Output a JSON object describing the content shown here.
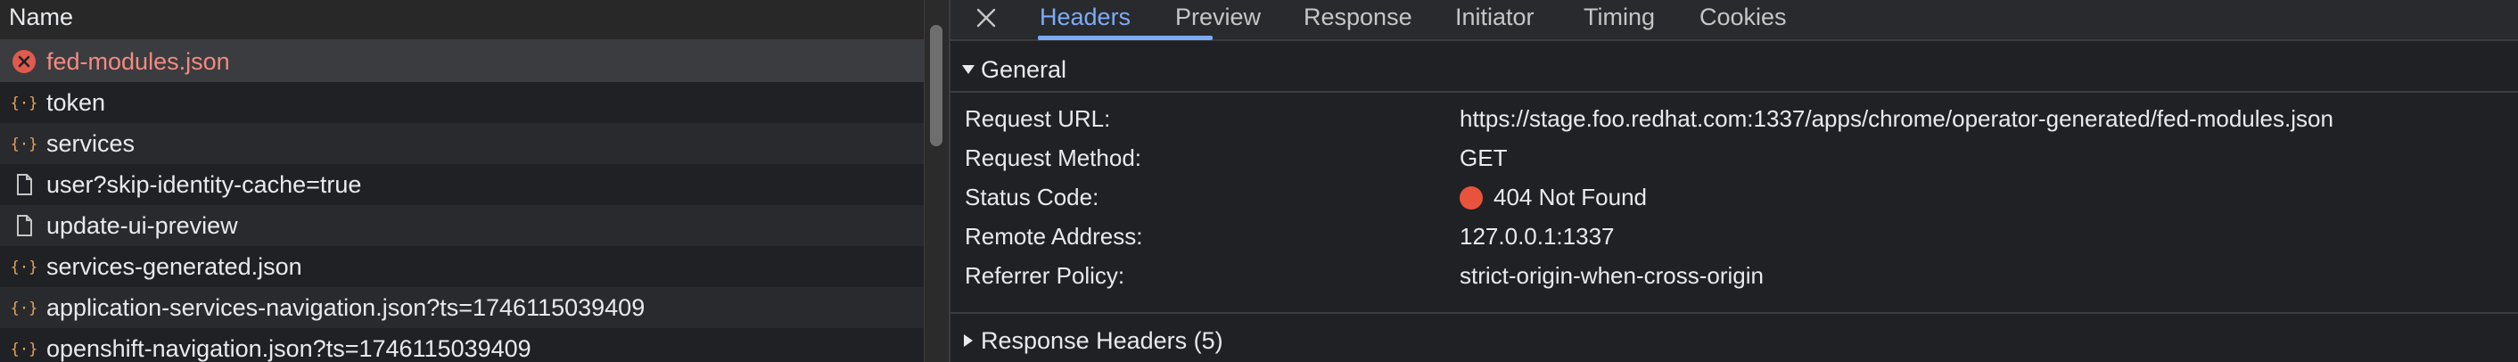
{
  "list": {
    "header": "Name",
    "rows": [
      {
        "label": "fed-modules.json",
        "icon": "error-icon",
        "status": "error"
      },
      {
        "label": "token",
        "icon": "json-icon"
      },
      {
        "label": "services",
        "icon": "json-icon"
      },
      {
        "label": "user?skip-identity-cache=true",
        "icon": "document-icon"
      },
      {
        "label": "update-ui-preview",
        "icon": "document-icon"
      },
      {
        "label": "services-generated.json",
        "icon": "json-icon"
      },
      {
        "label": "application-services-navigation.json?ts=1746115039409",
        "icon": "json-icon"
      },
      {
        "label": "openshift-navigation.json?ts=1746115039409",
        "icon": "json-icon"
      }
    ]
  },
  "tabs": {
    "items": [
      "Headers",
      "Preview",
      "Response",
      "Initiator",
      "Timing",
      "Cookies"
    ],
    "active": "Headers"
  },
  "general": {
    "title": "General",
    "request_url_key": "Request URL:",
    "request_url": "https://stage.foo.redhat.com:1337/apps/chrome/operator-generated/fed-modules.json",
    "request_method_key": "Request Method:",
    "request_method": "GET",
    "status_code_key": "Status Code:",
    "status_code": "404 Not Found",
    "remote_address_key": "Remote Address:",
    "remote_address": "127.0.0.1:1337",
    "referrer_policy_key": "Referrer Policy:",
    "referrer_policy": "strict-origin-when-cross-origin"
  },
  "response_headers": {
    "title": "Response Headers (5)"
  },
  "colors": {
    "accent": "#7cacf8",
    "error": "#f28b82",
    "status_dot": "#e8533e",
    "json_icon": "#e8a25a"
  }
}
